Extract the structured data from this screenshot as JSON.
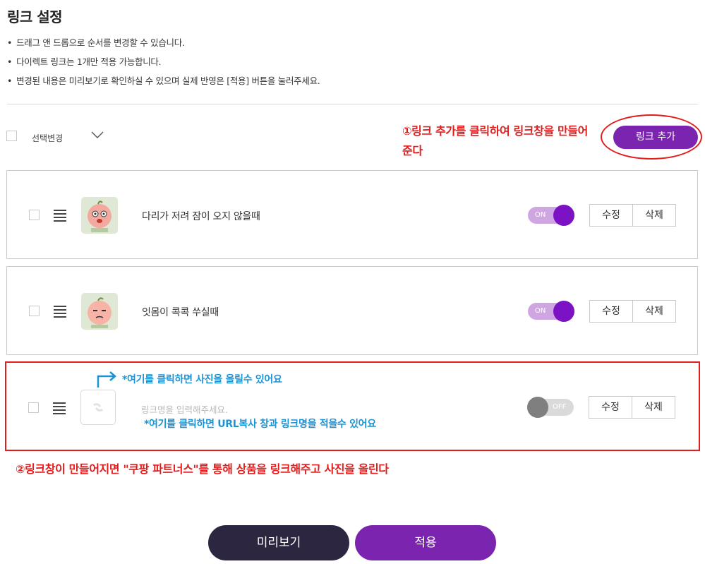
{
  "page": {
    "title": "링크 설정",
    "guides": [
      "드래그 앤 드롭으로 순서를 변경할 수 있습니다.",
      "다이렉트 링크는 1개만 적용 가능합니다.",
      "변경된 내용은 미리보기로 확인하실 수 있으며 실제 반영은 [적용] 버튼을 눌러주세요."
    ]
  },
  "toolbar": {
    "select_label": "선택변경",
    "add_link_label": "링크 추가"
  },
  "annotations": {
    "note1": "①링크 추가를 클릭하여 링크창을 만들어 준다",
    "note_photo": "*여기를 클릭하면 사진을 올릴수 있어요",
    "note_url": "*여기를 클릭하면 URL복사 창과 링크명을 적을수 있어요",
    "note2": "②링크창이 만들어지면 \"쿠팡 파트너스\"를 통해 상품을 링크해주고 사진을 올린다"
  },
  "links": [
    {
      "title": "다리가 저려 잠이 오지 않을때",
      "toggle": "ON",
      "edit": "수정",
      "delete": "삭제"
    },
    {
      "title": "잇몸이 콕콕 쑤실때",
      "toggle": "ON",
      "edit": "수정",
      "delete": "삭제"
    }
  ],
  "new_link": {
    "placeholder": "링크명을 입력해주세요.",
    "toggle": "OFF",
    "edit": "수정",
    "delete": "삭제"
  },
  "footer": {
    "preview_label": "미리보기",
    "apply_label": "적용"
  },
  "colors": {
    "accent": "#7b24b0",
    "dark_button": "#2c2640",
    "annotation_red": "#e21d1d",
    "annotation_blue": "#1c93d4"
  }
}
